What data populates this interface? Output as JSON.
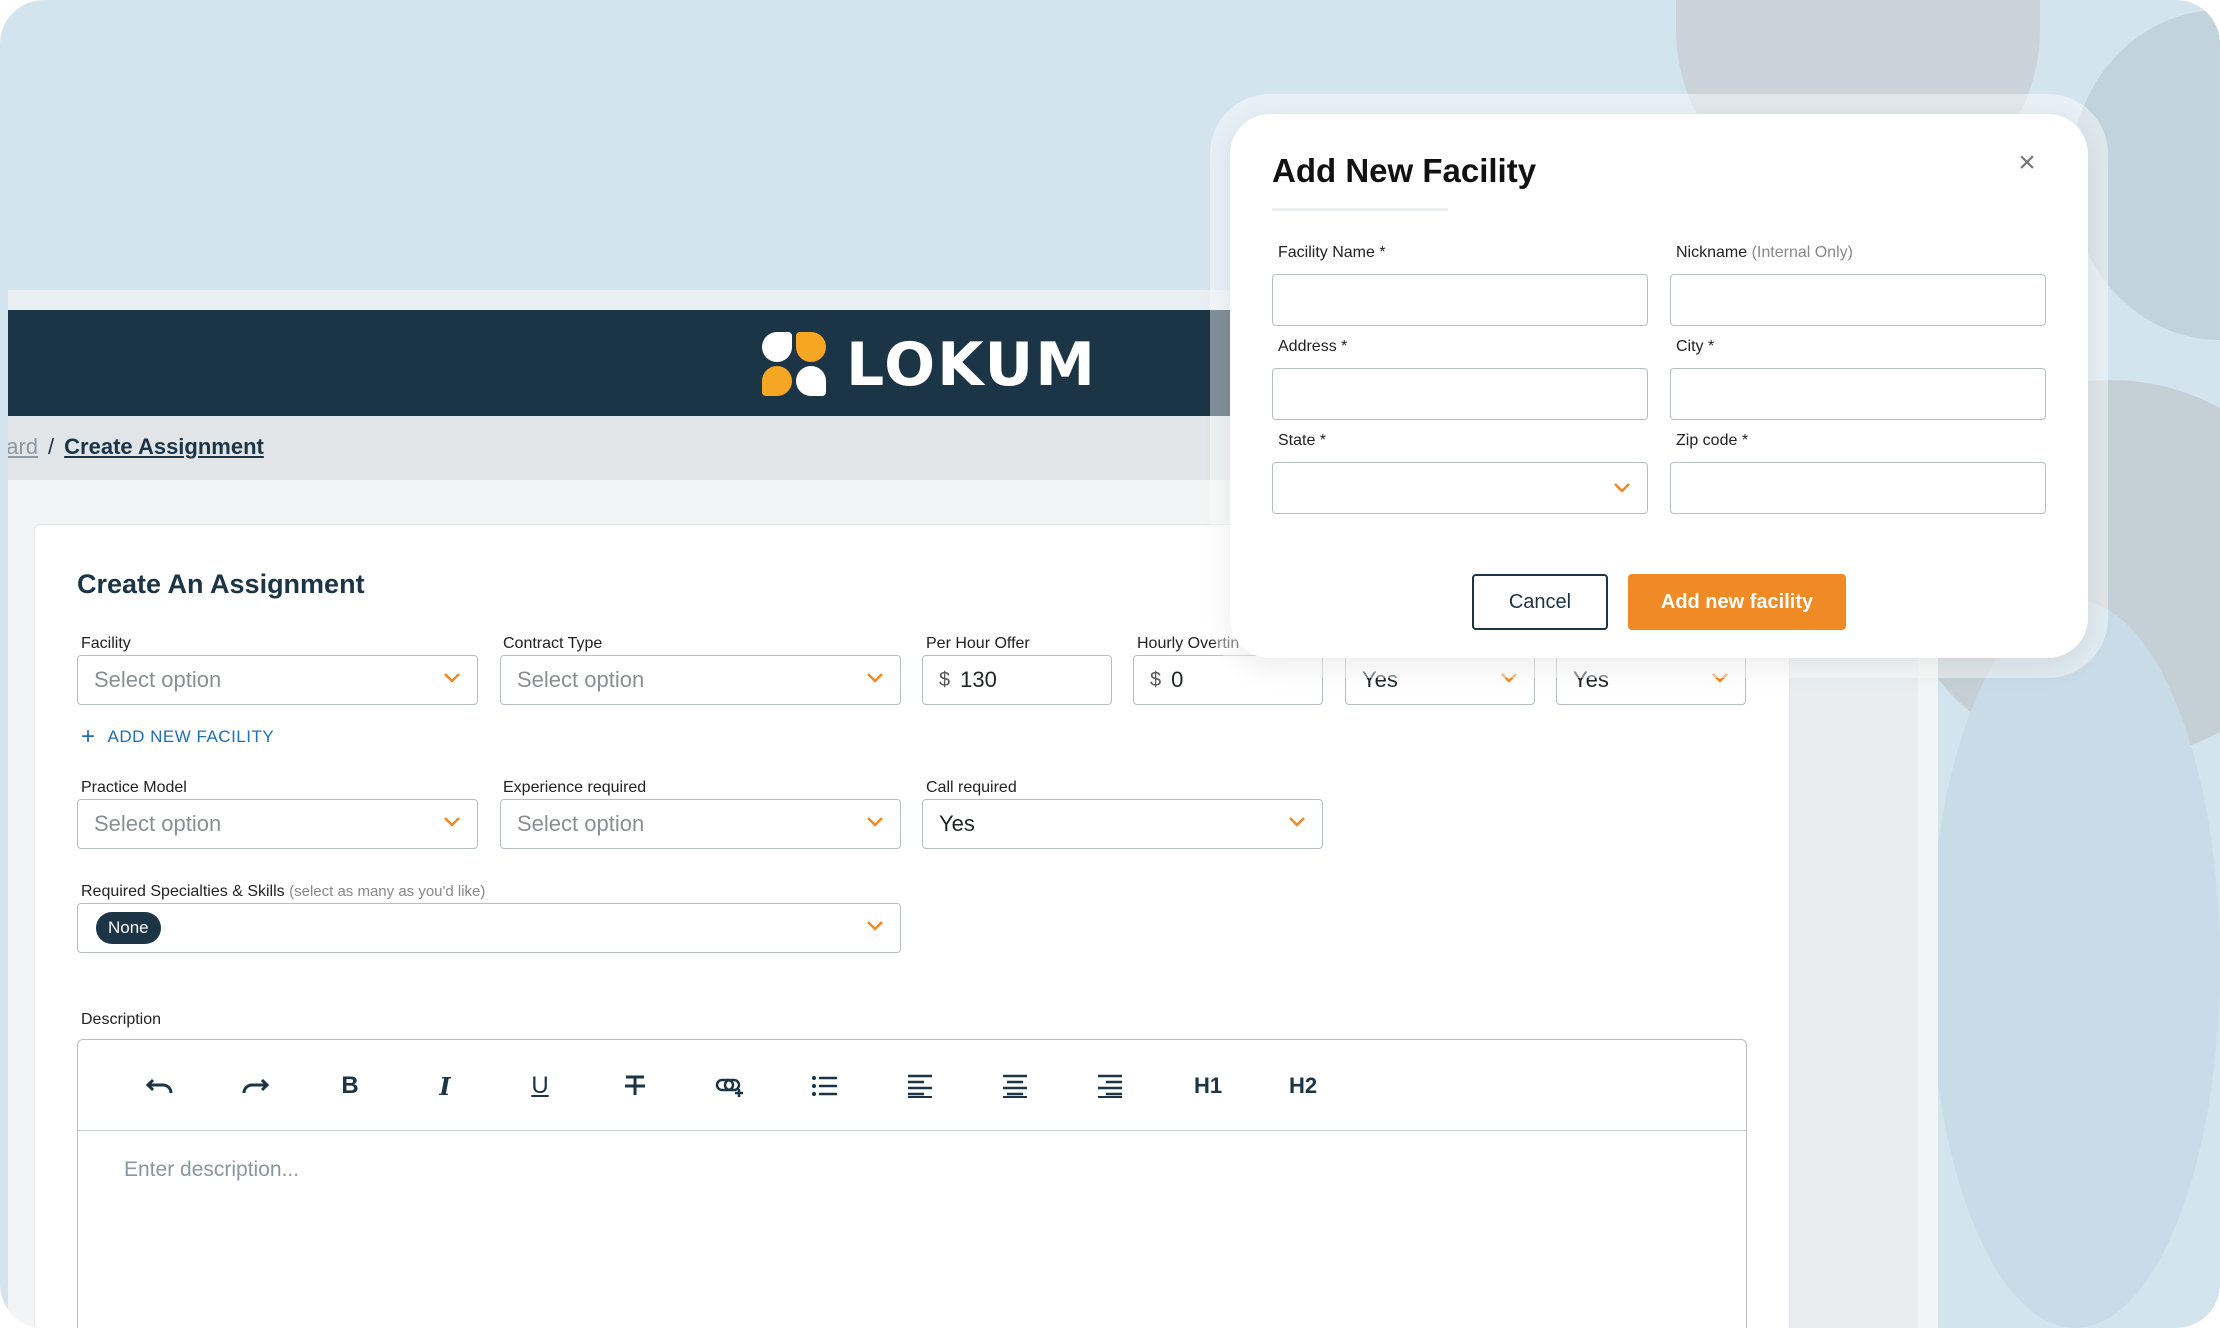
{
  "brand": {
    "name": "LOKUM"
  },
  "breadcrumb": {
    "dashboard": "oard",
    "separator": "/",
    "current": "Create Assignment"
  },
  "form": {
    "title": "Create An Assignment",
    "facility": {
      "label": "Facility",
      "placeholder": "Select option"
    },
    "contract_type": {
      "label": "Contract Type",
      "placeholder": "Select option"
    },
    "per_hour_offer": {
      "label": "Per Hour Offer",
      "currency": "$",
      "value": "130"
    },
    "hourly_overtime": {
      "label": "Hourly Overtin",
      "currency": "$",
      "value": "0"
    },
    "extra_select_1": {
      "value": "Yes"
    },
    "extra_select_2": {
      "value": "Yes"
    },
    "add_new_facility": "ADD NEW FACILITY",
    "practice_model": {
      "label": "Practice Model",
      "placeholder": "Select option"
    },
    "experience_required": {
      "label": "Experience required",
      "placeholder": "Select option"
    },
    "call_required": {
      "label": "Call required",
      "value": "Yes"
    },
    "specialties": {
      "label": "Required Specialties & Skills",
      "hint": "(select as many as you'd like)",
      "chip": "None"
    },
    "description": {
      "label": "Description",
      "placeholder": "Enter description...",
      "toolbar": [
        "undo-icon",
        "redo-icon",
        "bold-icon",
        "italic-icon",
        "underline-icon",
        "strikethrough-icon",
        "link-icon",
        "bullet-list-icon",
        "align-left-icon",
        "align-center-icon",
        "align-right-icon"
      ],
      "h1": "H1",
      "h2": "H2",
      "bold_glyph": "B",
      "italic_glyph": "I",
      "underline_glyph": "U"
    }
  },
  "modal": {
    "title": "Add New Facility",
    "close": "×",
    "facility_name": {
      "label": "Facility Name *"
    },
    "nickname": {
      "label": "Nickname",
      "hint": "(Internal Only)"
    },
    "address": {
      "label": "Address *"
    },
    "city": {
      "label": "City *"
    },
    "state": {
      "label": "State *"
    },
    "zip": {
      "label": "Zip code *"
    },
    "cancel": "Cancel",
    "submit": "Add new facility"
  },
  "colors": {
    "navy": "#1b3446",
    "orange": "#f08a24",
    "link": "#1f6fb5",
    "background": "#d4e4ee"
  }
}
